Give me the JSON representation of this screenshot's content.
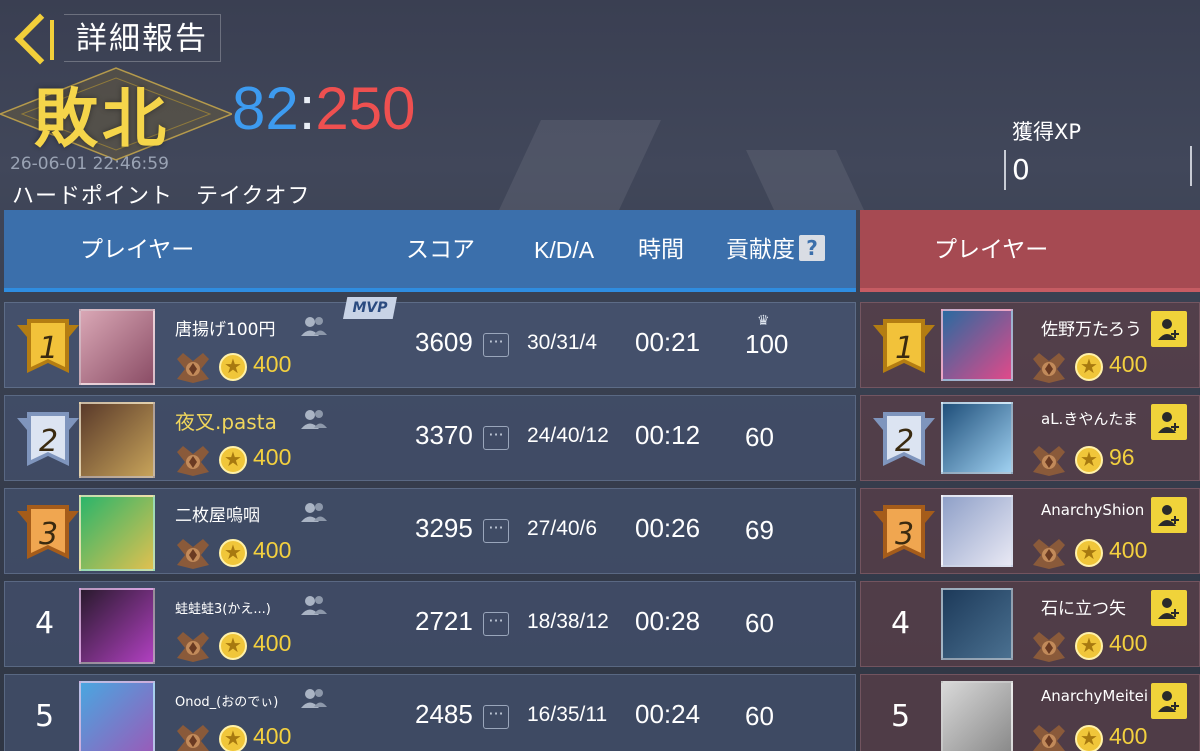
{
  "header": {
    "title": "詳細報告",
    "result": "敗北",
    "score_blue": "82",
    "score_sep": ":",
    "score_red": "250",
    "datetime": "26-06-01 22:46:59",
    "mode": "ハードポイント　テイクオフ",
    "xp_label": "獲得XP",
    "xp_value": "0"
  },
  "columns": {
    "player": "プレイヤー",
    "score": "スコア",
    "kda": "K/D/A",
    "time": "時間",
    "contribution": "貢献度",
    "help": "?"
  },
  "mvp_label": "MVP",
  "blue_team": [
    {
      "rank": "1",
      "name": "唐揚げ100円",
      "level": "400",
      "score": "3609",
      "kda": "30/31/4",
      "time": "00:21",
      "contribution": "100",
      "mvp": true
    },
    {
      "rank": "2",
      "name": "夜叉.pasta",
      "level": "400",
      "score": "3370",
      "kda": "24/40/12",
      "time": "00:12",
      "contribution": "60"
    },
    {
      "rank": "3",
      "name": "二枚屋嗚咽",
      "level": "400",
      "score": "3295",
      "kda": "27/40/6",
      "time": "00:26",
      "contribution": "69"
    },
    {
      "rank": "4",
      "name": "蛙蛙蛙3(かえ...)",
      "level": "400",
      "score": "2721",
      "kda": "18/38/12",
      "time": "00:28",
      "contribution": "60"
    },
    {
      "rank": "5",
      "name": "Onod_(おのでぃ)",
      "level": "400",
      "score": "2485",
      "kda": "16/35/11",
      "time": "00:24",
      "contribution": "60"
    }
  ],
  "red_team": [
    {
      "rank": "1",
      "name": "佐野万たろう",
      "level": "400"
    },
    {
      "rank": "2",
      "name": "aL.きやんたま",
      "level": "96"
    },
    {
      "rank": "3",
      "name": "AnarchyShion",
      "level": "400"
    },
    {
      "rank": "4",
      "name": "石に立つ矢",
      "level": "400"
    },
    {
      "rank": "5",
      "name": "AnarchyMeitei",
      "level": "400"
    }
  ],
  "colors": {
    "gold": "#f2cf3a",
    "blue_team": "#3b6fab",
    "red_team": "#a64a52",
    "score_blue": "#3d9bf0",
    "score_red": "#ee5050"
  }
}
